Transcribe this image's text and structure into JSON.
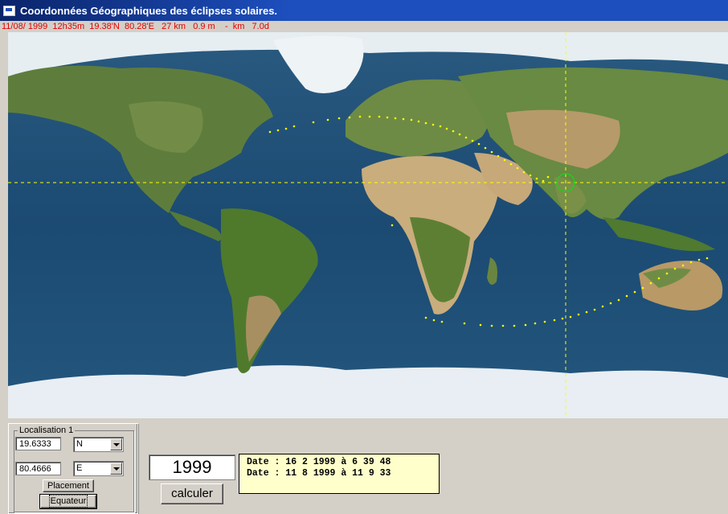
{
  "window": {
    "title": "Coordonnées Géographiques des éclipses solaires."
  },
  "status_line": "11/08/ 1999  12h35m  19.38'N  80.28'E   27 km   0.9 m    -  km   7.0d",
  "localisation": {
    "group_label": "Localisation 1",
    "latitude_value": "19.6333",
    "latitude_hemisphere": "N",
    "longitude_value": "80.4666",
    "longitude_hemisphere": "E",
    "placement_label": "Placement",
    "equateur_label": "Equateur"
  },
  "year_value": "1999",
  "calculate_label": "calculer",
  "eclipse_dates": [
    "Date : 16 2 1999 à 6 39 48",
    "Date : 11 8 1999 à 11 9 33"
  ],
  "colors": {
    "titlebar": "#1d4fbe",
    "status_text": "#e00000",
    "eclipse_path": "#ffff00",
    "crosshair": "#ffff00",
    "location_marker": "#22cc22",
    "dates_panel": "#ffffcc"
  },
  "icons": {
    "app": "window-app-icon",
    "dropdown": "chevron-down-icon"
  }
}
